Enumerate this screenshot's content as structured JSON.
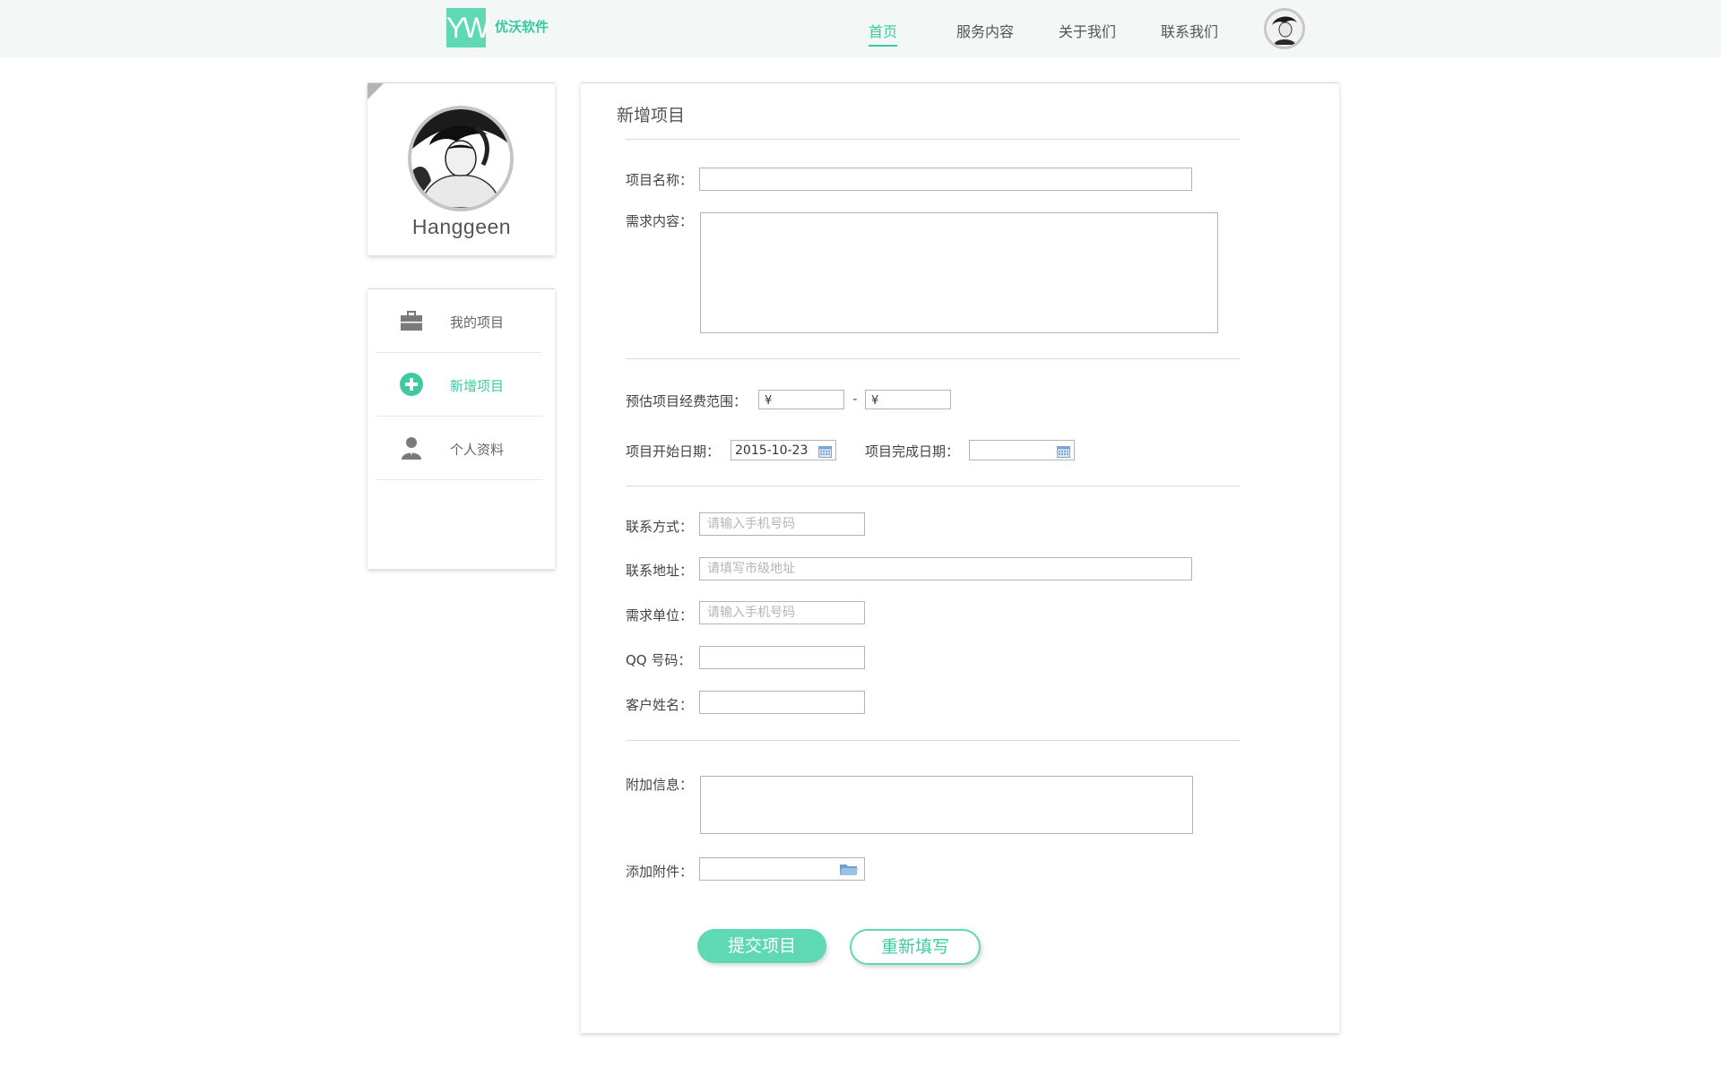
{
  "brand": {
    "logo_mark": "YW",
    "name": "优沃软件",
    "accent_color": "#5fd9b3"
  },
  "nav": {
    "items": [
      {
        "label": "首页",
        "active": true
      },
      {
        "label": "服务内容",
        "active": false
      },
      {
        "label": "关于我们",
        "active": false
      },
      {
        "label": "联系我们",
        "active": false
      }
    ]
  },
  "profile": {
    "username": "Hanggeen"
  },
  "sidebar": {
    "items": [
      {
        "label": "我的项目",
        "icon": "briefcase-icon",
        "active": false
      },
      {
        "label": "新增项目",
        "icon": "plus-circle-icon",
        "active": true
      },
      {
        "label": "个人资料",
        "icon": "user-icon",
        "active": false
      }
    ]
  },
  "form": {
    "title": "新增项目",
    "project_name_label": "项目名称：",
    "requirement_label": "需求内容：",
    "budget_label": "预估项目经费范围：",
    "budget_min_prefix": "¥",
    "budget_max_prefix": "¥",
    "budget_dash": "-",
    "start_date_label": "项目开始日期：",
    "start_date_value": "2015-10-23",
    "end_date_label": "项目完成日期：",
    "end_date_value": "",
    "contact_label": "联系方式：",
    "contact_placeholder": "请输入手机号码",
    "address_label": "联系地址：",
    "address_placeholder": "请填写市级地址",
    "unit_label": "需求单位：",
    "unit_placeholder": "请输入手机号码",
    "qq_label": "QQ 号码：",
    "client_label": "客户姓名：",
    "extra_label": "附加信息：",
    "attachment_label": "添加附件：",
    "submit_label": "提交项目",
    "reset_label": "重新填写"
  }
}
